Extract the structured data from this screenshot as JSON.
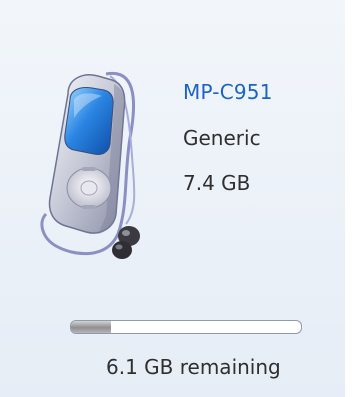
{
  "device": {
    "name": "MP-C951",
    "manufacturer": "Generic",
    "capacity": "7.4 GB",
    "icon": "media-player-with-earbuds-icon"
  },
  "storage": {
    "remaining_text": "6.1 GB remaining",
    "used_fraction": 0.1757
  },
  "colors": {
    "name_link": "#1b63c8",
    "text": "#2f2f2f",
    "panel_background": "#eaf0f7"
  }
}
